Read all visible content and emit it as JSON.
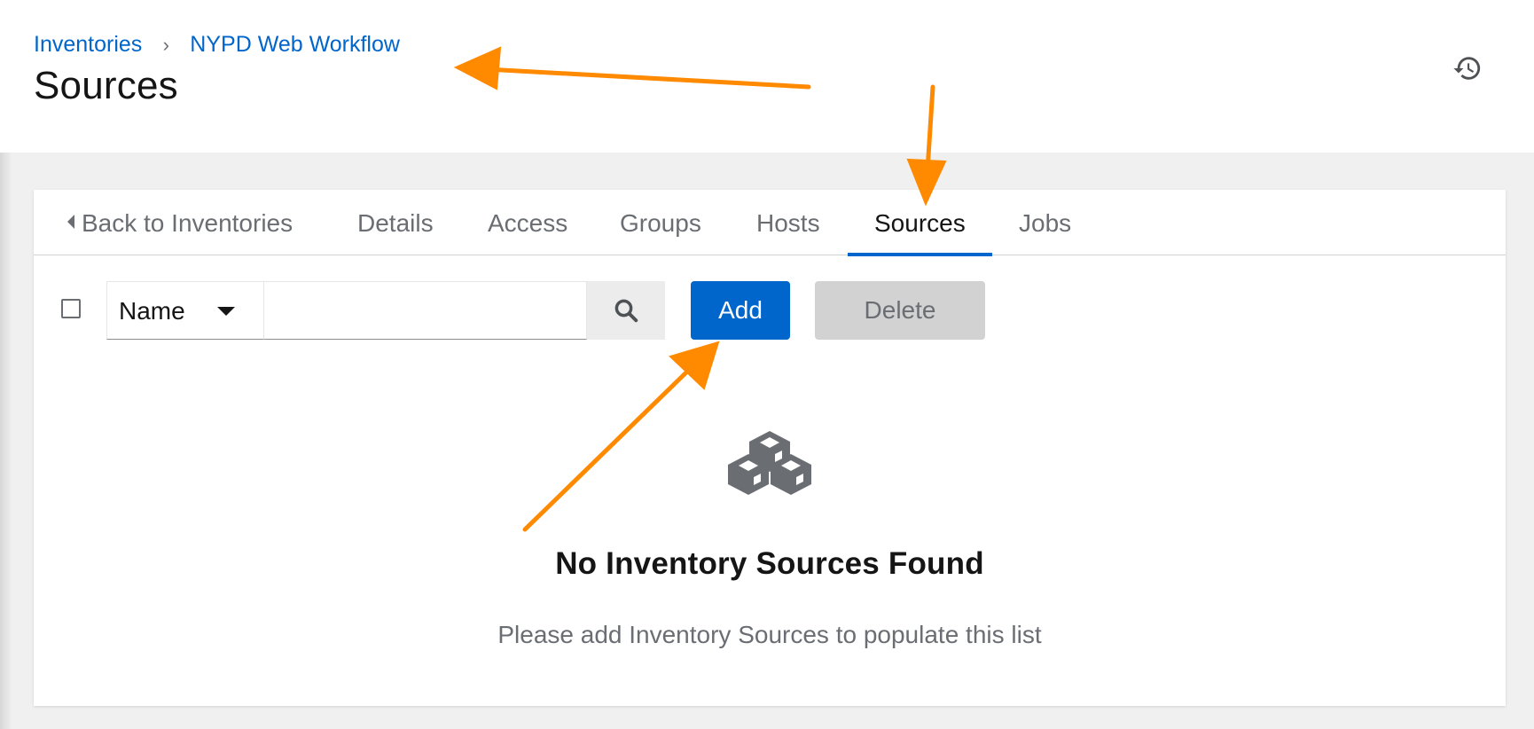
{
  "breadcrumb": {
    "parent": "Inventories",
    "separator": "›",
    "current": "NYPD Web Workflow"
  },
  "page_title": "Sources",
  "header_icon": "history-icon",
  "tabs": [
    {
      "label": "Back to Inventories",
      "icon": "caret-left-icon",
      "active": false
    },
    {
      "label": "Details",
      "active": false
    },
    {
      "label": "Access",
      "active": false
    },
    {
      "label": "Groups",
      "active": false
    },
    {
      "label": "Hosts",
      "active": false
    },
    {
      "label": "Sources",
      "active": true
    },
    {
      "label": "Jobs",
      "active": false
    }
  ],
  "toolbar": {
    "filter_field": "Name",
    "search_value": "",
    "search_icon": "search-icon",
    "add_label": "Add",
    "delete_label": "Delete"
  },
  "empty_state": {
    "icon": "cubes-icon",
    "title": "No Inventory Sources Found",
    "body": "Please add Inventory Sources to populate this list"
  },
  "colors": {
    "accent": "#0066cc",
    "annotation_arrow": "#ff8a00",
    "disabled_button": "#d2d2d2"
  }
}
